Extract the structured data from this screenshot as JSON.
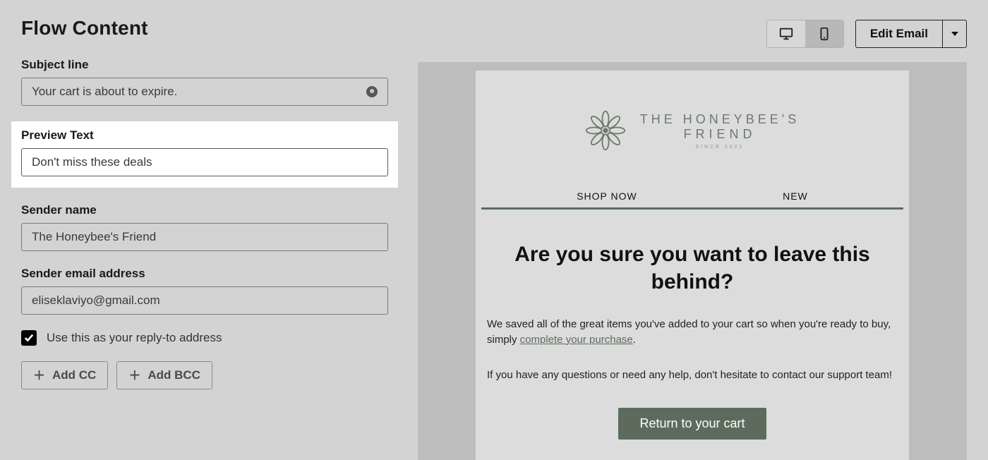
{
  "title": "Flow Content",
  "fields": {
    "subject": {
      "label": "Subject line",
      "value": "Your cart is about to expire."
    },
    "preview": {
      "label": "Preview Text",
      "value": "Don't miss these deals"
    },
    "sender_name": {
      "label": "Sender name",
      "value": "The Honeybee's Friend"
    },
    "sender_email": {
      "label": "Sender email address",
      "value": "eliseklaviyo@gmail.com"
    }
  },
  "reply_to": {
    "label": "Use this as your reply-to address",
    "checked": true
  },
  "buttons": {
    "add_cc": "Add CC",
    "add_bcc": "Add BCC",
    "edit_email": "Edit Email"
  },
  "email_preview": {
    "brand_line1": "THE HONEYBEE'S",
    "brand_line2": "FRIEND",
    "brand_since": "SINCE 2021",
    "nav": {
      "shop": "SHOP NOW",
      "new": "NEW"
    },
    "headline": "Are you sure you want to leave this behind?",
    "body1_a": "We saved all of the great items you've added to your cart so when you're ready to buy, simply ",
    "body1_link": "complete your purchase",
    "body1_b": ".",
    "body2": "If you have any questions or need any help, don't hesitate to contact our support team!",
    "cta": "Return to your cart"
  },
  "colors": {
    "accent": "#5d6b5d"
  }
}
